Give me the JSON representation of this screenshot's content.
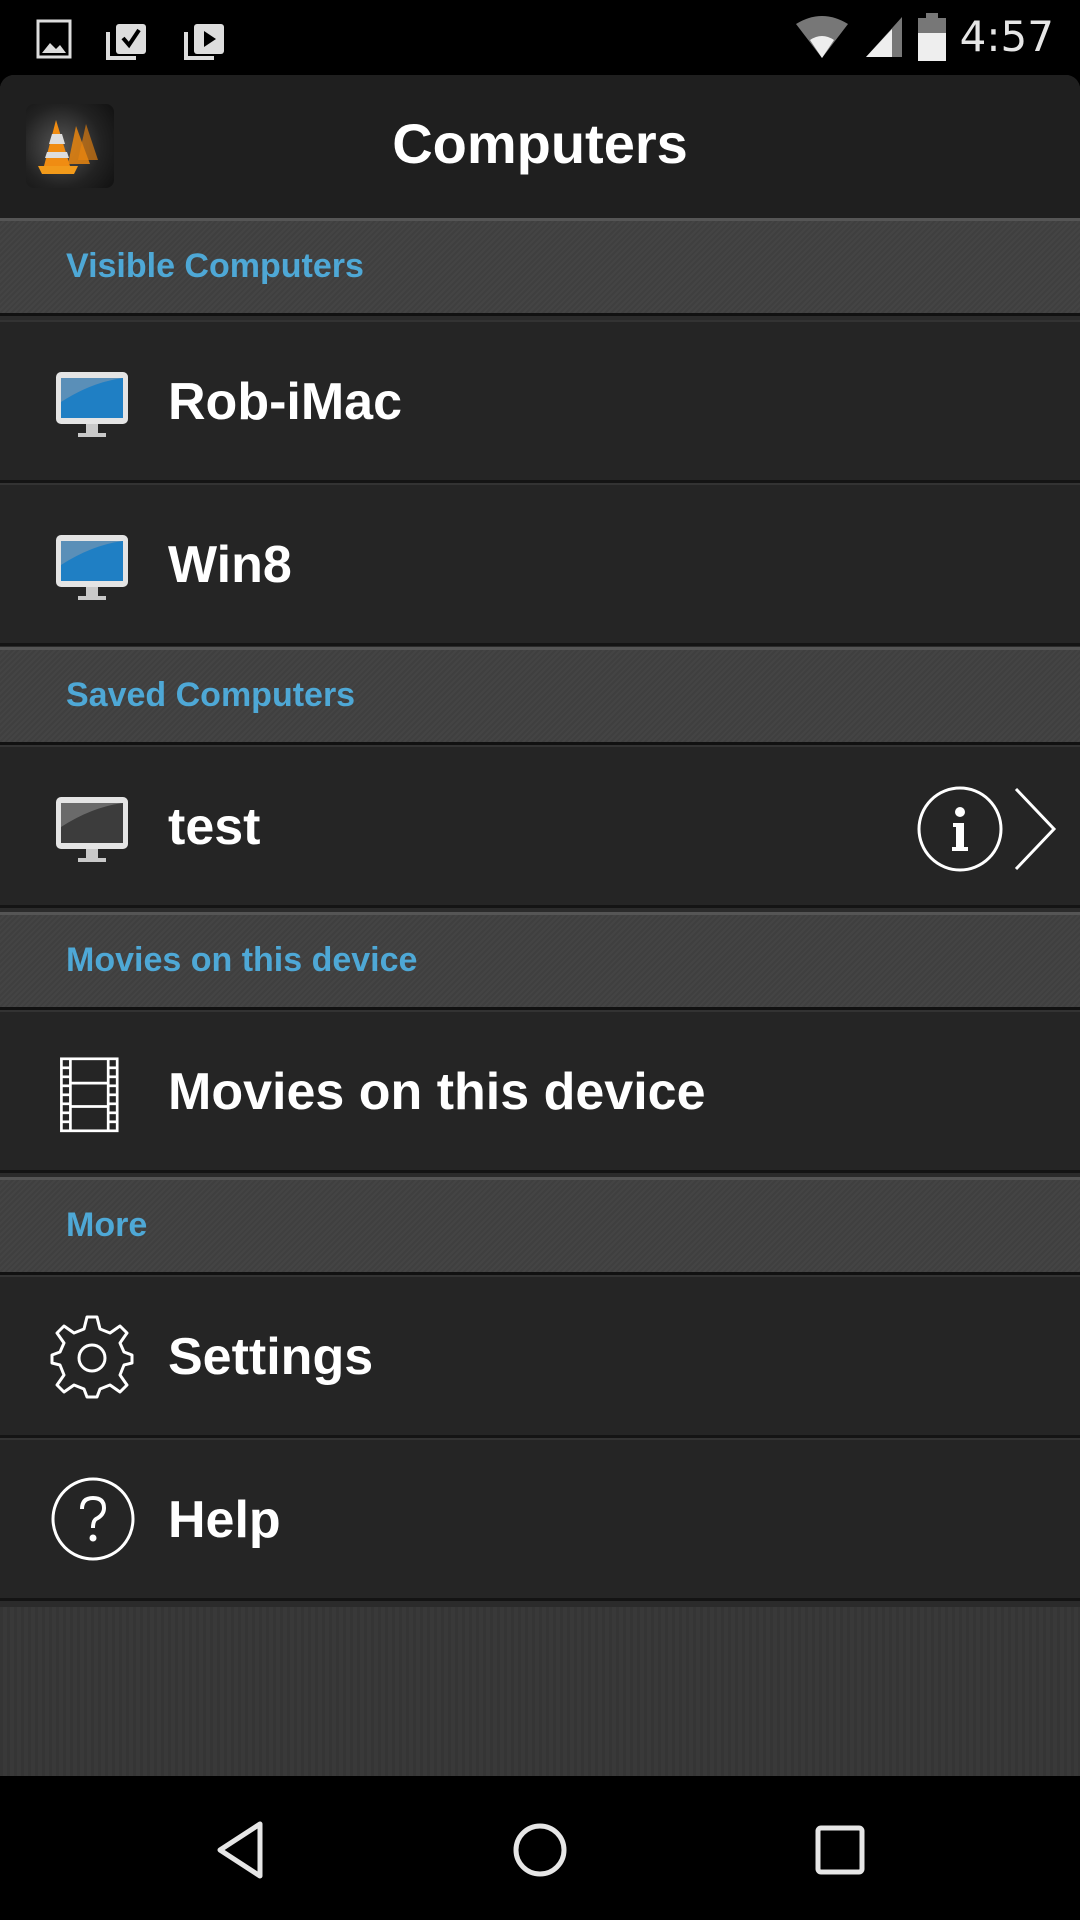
{
  "status_bar": {
    "left_icons": [
      "image-notification-icon",
      "clipboard-check-icon",
      "clipboard-play-icon"
    ],
    "right_icons": [
      "wifi-icon",
      "cell-signal-icon",
      "battery-icon"
    ],
    "time": "4:57"
  },
  "header": {
    "title": "Computers",
    "logo": "vlc-cone-logo"
  },
  "sections": {
    "visible": {
      "title": "Visible Computers",
      "items": [
        {
          "label": "Rob-iMac"
        },
        {
          "label": "Win8"
        }
      ]
    },
    "saved": {
      "title": "Saved Computers",
      "items": [
        {
          "label": "test"
        }
      ]
    },
    "movies": {
      "title": "Movies on this device",
      "items": [
        {
          "label": "Movies on this device"
        }
      ]
    },
    "more": {
      "title": "More",
      "items": [
        {
          "label": "Settings"
        },
        {
          "label": "Help"
        }
      ]
    }
  },
  "colors": {
    "section_title": "#4ea8d6",
    "background": "#252525",
    "header": "#1f1f1f"
  },
  "nav_bar": [
    "back-icon",
    "home-icon",
    "recents-icon"
  ]
}
